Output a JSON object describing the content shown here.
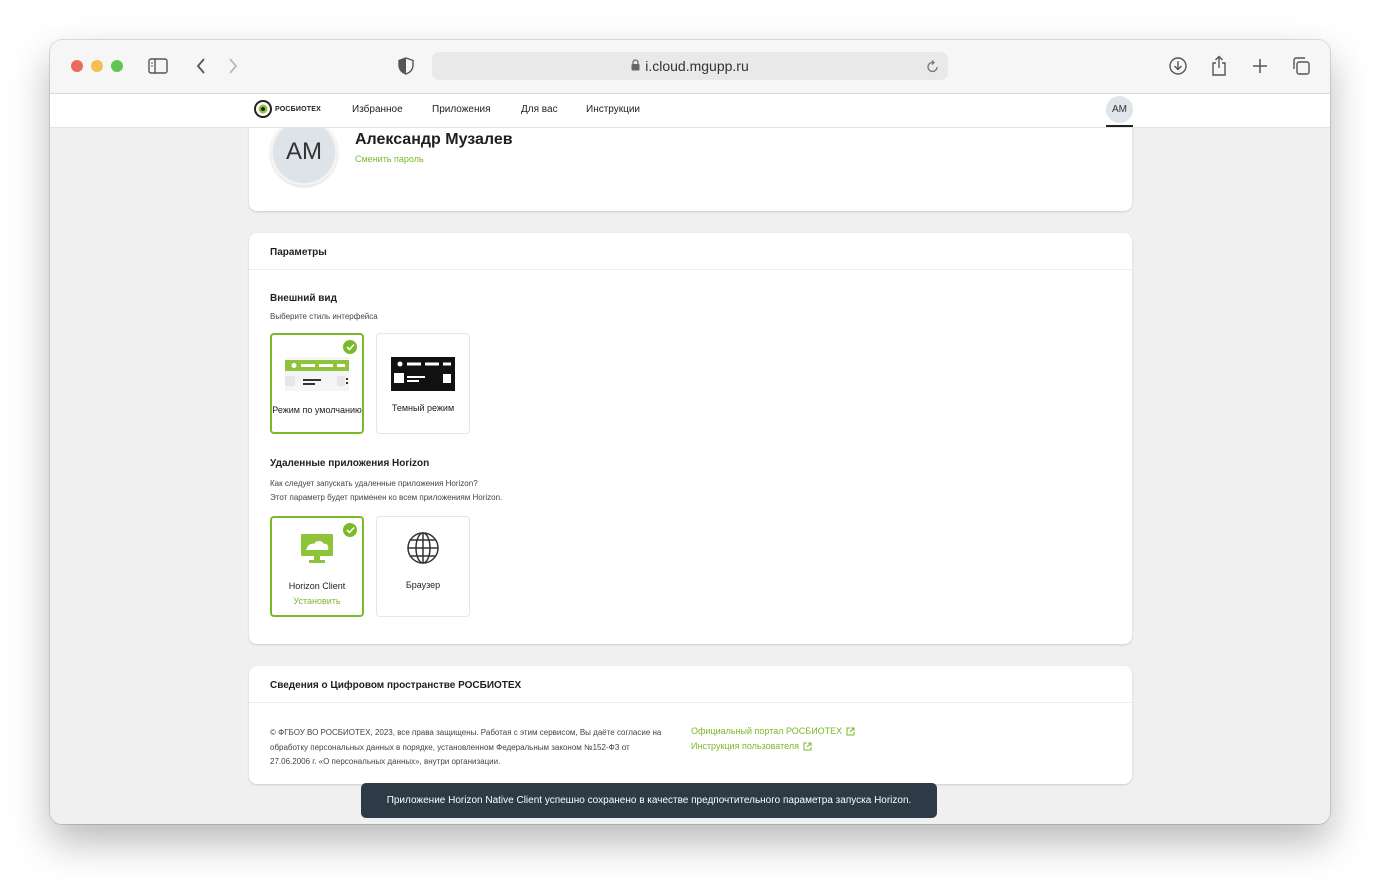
{
  "browser": {
    "url": "i.cloud.mgupp.ru"
  },
  "nav": {
    "logo_text": "РОСБИОТЕХ",
    "items": [
      "Избранное",
      "Приложения",
      "Для вас",
      "Инструкции"
    ],
    "avatar_initials": "АМ"
  },
  "profile": {
    "initials": "АМ",
    "name": "Александр Музалев",
    "change_password": "Сменить пароль"
  },
  "settings": {
    "title": "Параметры",
    "appearance": {
      "title": "Внешний вид",
      "subtitle": "Выберите стиль интерфейса",
      "options": [
        {
          "label": "Режим по умолчанию",
          "selected": true
        },
        {
          "label": "Темный режим",
          "selected": false
        }
      ]
    },
    "horizon": {
      "title": "Удаленные приложения Horizon",
      "line1": "Как следует запускать удаленные приложения Horizon?",
      "line2": "Этот параметр будет применен ко всем приложениям Horizon.",
      "options": [
        {
          "label": "Horizon Client",
          "sub": "Установить",
          "selected": true
        },
        {
          "label": "Браузер",
          "selected": false
        }
      ]
    }
  },
  "info": {
    "title": "Сведения о Цифровом пространстве РОСБИОТЕХ",
    "text": "© ФГБОУ ВО РОСБИОТЕХ, 2023, все права защищены. Работая с этим сервисом, Вы даёте согласие на обработку персональных данных в порядке, установленном Федеральным законом №152-ФЗ от 27.06.2006 г. «О персональных данных», внутри организации.",
    "links": [
      "Официальный портал РОСБИОТЕХ",
      "Инструкция пользователя"
    ]
  },
  "toast": "Приложение Horizon Native Client успешно сохранено в качестве предпочтительного параметра запуска Horizon.",
  "colors": {
    "accent": "#7ab92a",
    "toast_bg": "#2e3a45"
  }
}
